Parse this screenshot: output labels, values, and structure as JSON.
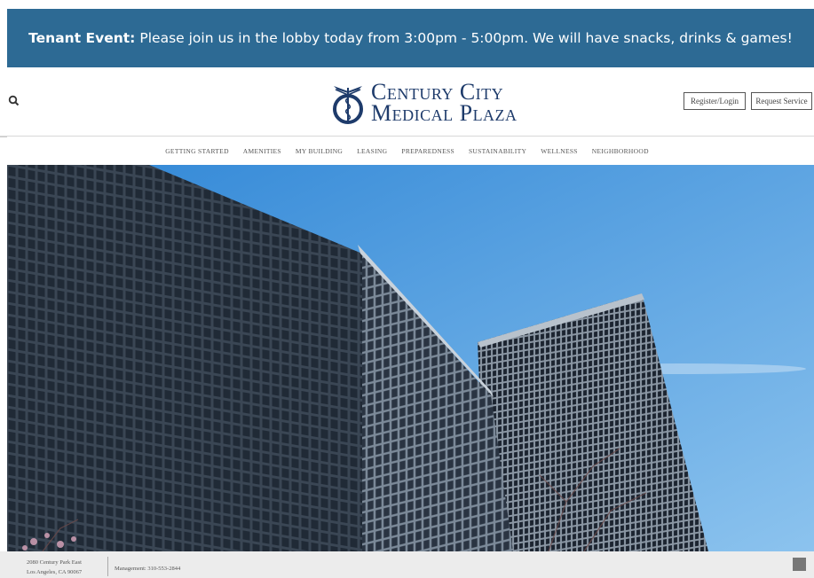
{
  "banner": {
    "label": "Tenant Event:",
    "message": "Please join us in the lobby today from 3:00pm - 5:00pm. We will have snacks, drinks & games!"
  },
  "header": {
    "search_icon": "search-icon",
    "logo": {
      "line1": "Century City",
      "line2": "Medical Plaza"
    },
    "register_label": "Register/Login",
    "request_label": "Request Service"
  },
  "nav": {
    "items": [
      "GETTING STARTED",
      "AMENITIES",
      "MY BUILDING",
      "LEASING",
      "PREPAREDNESS",
      "SUSTAINABILITY",
      "WELLNESS",
      "NEIGHBORHOOD"
    ]
  },
  "footer": {
    "address_line1": "2080 Century Park East",
    "address_line2": "Los Angeles, CA 90067",
    "management": "Management: 310-553-2844"
  },
  "colors": {
    "banner": "#2d6a94",
    "logo": "#1e3b6b",
    "sky": "#3e8fd8"
  }
}
